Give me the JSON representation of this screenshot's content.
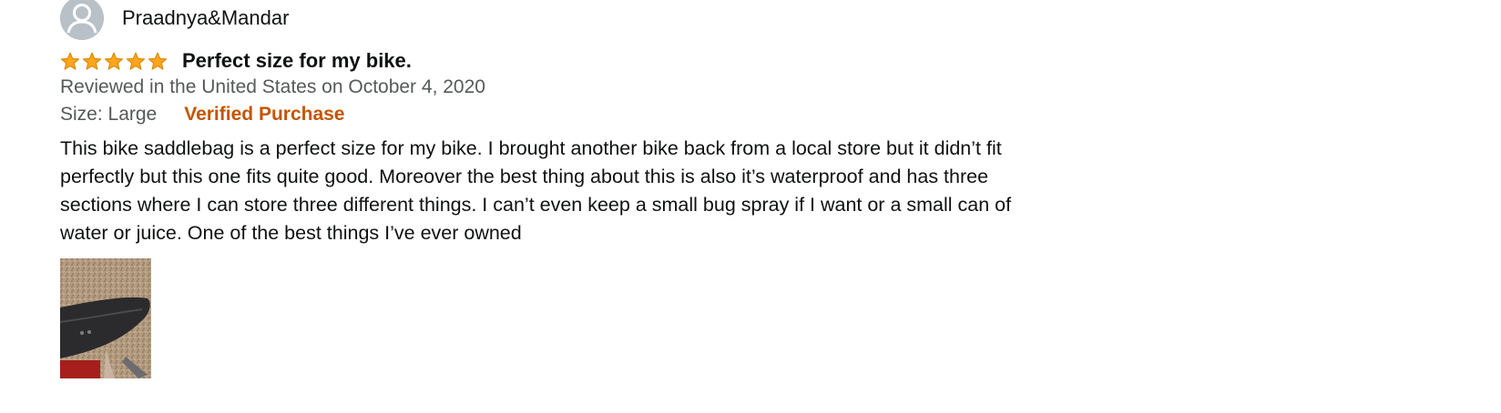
{
  "review": {
    "profile": {
      "name": "Praadnya&Mandar",
      "avatar_icon": "default-user-avatar-icon"
    },
    "rating": {
      "stars": 5,
      "max": 5,
      "star_color": "#ffa41c"
    },
    "title": "Perfect size for my bike.",
    "date": "Reviewed in the United States on October 4, 2020",
    "size": "Size: Large",
    "verified": "Verified Purchase",
    "verified_color": "#c45500",
    "body": "This bike saddlebag is a perfect size for my bike. I brought another bike back from a local store but it didn’t fit perfectly but this one fits quite good. Moreover the best thing about this is also it’s waterproof and has three sections where I can store three different things. I can’t even keep a small bug spray if I want or a small can of water or juice. One of the best things I’ve ever owned",
    "images": [
      {
        "description": "customer-photo"
      }
    ]
  }
}
